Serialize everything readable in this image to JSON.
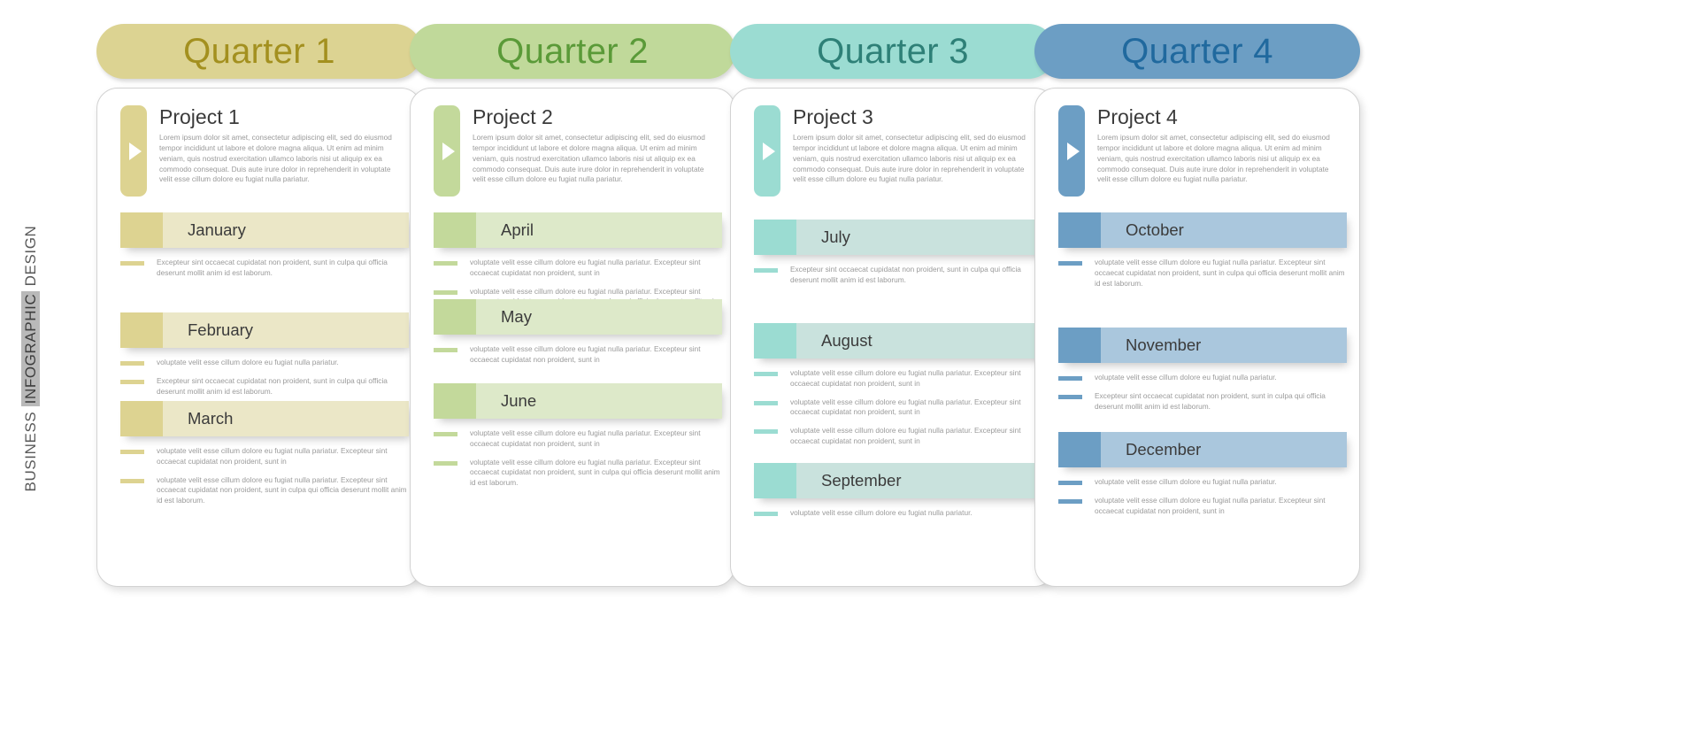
{
  "side_label": {
    "prefix": "BUSINESS ",
    "highlight": "INFOGRAPHIC",
    "suffix": " DESIGN"
  },
  "palette": {
    "q1_banner_bg": "#dcd392",
    "q1_banner_text": "#a3901f",
    "q1_dark": "#ddd391",
    "q1_light": "#ebe7c7",
    "q2_banner_bg": "#c0d99a",
    "q2_banner_text": "#5a9a38",
    "q2_dark": "#c3d99b",
    "q2_light": "#dde9c9",
    "q3_banner_bg": "#9bdcd2",
    "q3_banner_text": "#2e8077",
    "q3_dark": "#9bdcd2",
    "q3_light": "#c9e2dd",
    "q4_banner_bg": "#6c9ec4",
    "q4_banner_text": "#20699e",
    "q4_dark": "#6c9ec4",
    "q4_light": "#aac7dd"
  },
  "quarters": [
    {
      "banner_label": "Quarter 1",
      "banner_bg": "#dcd392",
      "banner_text_color": "#a3901f",
      "dark": "#ddd391",
      "light": "#ebe7c7",
      "project_title": "Project 1",
      "project_body": "Lorem ipsum dolor sit amet, consectetur adipiscing elit, sed do eiusmod tempor incididunt ut labore et dolore magna aliqua. Ut enim ad minim veniam, quis nostrud exercitation ullamco laboris nisi ut aliquip ex ea commodo consequat. Duis aute irure dolor in reprehenderit in voluptate velit esse cillum dolore eu fugiat nulla pariatur.",
      "months": [
        {
          "name": "January",
          "bullets": [
            "Excepteur sint occaecat cupidatat non proident, sunt in culpa qui officia deserunt mollit anim id est laborum."
          ]
        },
        {
          "name": "February",
          "bullets": [
            "voluptate velit esse cillum dolore eu fugiat nulla pariatur.",
            "Excepteur sint occaecat cupidatat non proident, sunt in culpa qui officia deserunt mollit anim id est laborum."
          ]
        },
        {
          "name": "March",
          "bullets": [
            "voluptate velit esse cillum dolore eu fugiat nulla pariatur. Excepteur sint occaecat cupidatat non proident, sunt in",
            "voluptate velit esse cillum dolore eu fugiat nulla pariatur. Excepteur sint occaecat cupidatat non proident, sunt in culpa qui officia deserunt mollit anim id est laborum."
          ]
        }
      ]
    },
    {
      "banner_label": "Quarter 2",
      "banner_bg": "#c0d99a",
      "banner_text_color": "#5a9a38",
      "dark": "#c3d99b",
      "light": "#dde9c9",
      "project_title": "Project 2",
      "project_body": "Lorem ipsum dolor sit amet, consectetur adipiscing elit, sed do eiusmod tempor incididunt ut labore et dolore magna aliqua. Ut enim ad minim veniam, quis nostrud exercitation ullamco laboris nisi ut aliquip ex ea commodo consequat. Duis aute irure dolor in reprehenderit in voluptate velit esse cillum dolore eu fugiat nulla pariatur.",
      "months": [
        {
          "name": "April",
          "bullets": [
            "voluptate velit esse cillum dolore eu fugiat nulla pariatur. Excepteur sint occaecat cupidatat non proident, sunt in",
            "voluptate velit esse cillum dolore eu fugiat nulla pariatur. Excepteur sint occaecat cupidatat non proident, sunt in culpa qui officia deserunt mollit anim id est laborum."
          ]
        },
        {
          "name": "May",
          "bullets": [
            "voluptate velit esse cillum dolore eu fugiat nulla pariatur. Excepteur sint occaecat cupidatat non proident, sunt in"
          ]
        },
        {
          "name": "June",
          "bullets": [
            "voluptate velit esse cillum dolore eu fugiat nulla pariatur. Excepteur sint occaecat cupidatat non proident, sunt in",
            "voluptate velit esse cillum dolore eu fugiat nulla pariatur. Excepteur sint occaecat cupidatat non proident, sunt in culpa qui officia deserunt mollit anim id est laborum."
          ]
        }
      ]
    },
    {
      "banner_label": "Quarter 3",
      "banner_bg": "#9bdcd2",
      "banner_text_color": "#2e8077",
      "dark": "#9bdcd2",
      "light": "#c9e2dd",
      "project_title": "Project 3",
      "project_body": "Lorem ipsum dolor sit amet, consectetur adipiscing elit, sed do eiusmod tempor incididunt ut labore et dolore magna aliqua. Ut enim ad minim veniam, quis nostrud exercitation ullamco laboris nisi ut aliquip ex ea commodo consequat. Duis aute irure dolor in reprehenderit in voluptate velit esse cillum dolore eu fugiat nulla pariatur.",
      "months": [
        {
          "name": "July",
          "bullets": [
            "Excepteur sint occaecat cupidatat non proident, sunt in culpa qui officia deserunt mollit anim id est laborum."
          ]
        },
        {
          "name": "August",
          "bullets": [
            "voluptate velit esse cillum dolore eu fugiat nulla pariatur. Excepteur sint occaecat cupidatat non proident, sunt in",
            "voluptate velit esse cillum dolore eu fugiat nulla pariatur. Excepteur sint occaecat cupidatat non proident, sunt in",
            "voluptate velit esse cillum dolore eu fugiat nulla pariatur. Excepteur sint occaecat cupidatat non proident, sunt in"
          ]
        },
        {
          "name": "September",
          "bullets": [
            "voluptate velit esse cillum dolore eu fugiat nulla pariatur."
          ]
        }
      ]
    },
    {
      "banner_label": "Quarter 4",
      "banner_bg": "#6c9ec4",
      "banner_text_color": "#20699e",
      "dark": "#6c9ec4",
      "light": "#aac7dd",
      "project_title": "Project 4",
      "project_body": "Lorem ipsum dolor sit amet, consectetur adipiscing elit, sed do eiusmod tempor incididunt ut labore et dolore magna aliqua. Ut enim ad minim veniam, quis nostrud exercitation ullamco laboris nisi ut aliquip ex ea commodo consequat. Duis aute irure dolor in reprehenderit in voluptate velit esse cillum dolore eu fugiat nulla pariatur.",
      "months": [
        {
          "name": "October",
          "bullets": [
            "voluptate velit esse cillum dolore eu fugiat nulla pariatur. Excepteur sint occaecat cupidatat non proident, sunt in culpa qui officia deserunt mollit anim id est laborum."
          ]
        },
        {
          "name": "November",
          "bullets": [
            "voluptate velit esse cillum dolore eu fugiat nulla pariatur.",
            "Excepteur sint occaecat cupidatat non proident, sunt in culpa qui officia deserunt mollit anim id est laborum."
          ]
        },
        {
          "name": "December",
          "bullets": [
            "voluptate velit esse cillum dolore eu fugiat nulla pariatur.",
            "voluptate velit esse cillum dolore eu fugiat nulla pariatur. Excepteur sint occaecat cupidatat non proident, sunt in"
          ]
        }
      ]
    }
  ]
}
